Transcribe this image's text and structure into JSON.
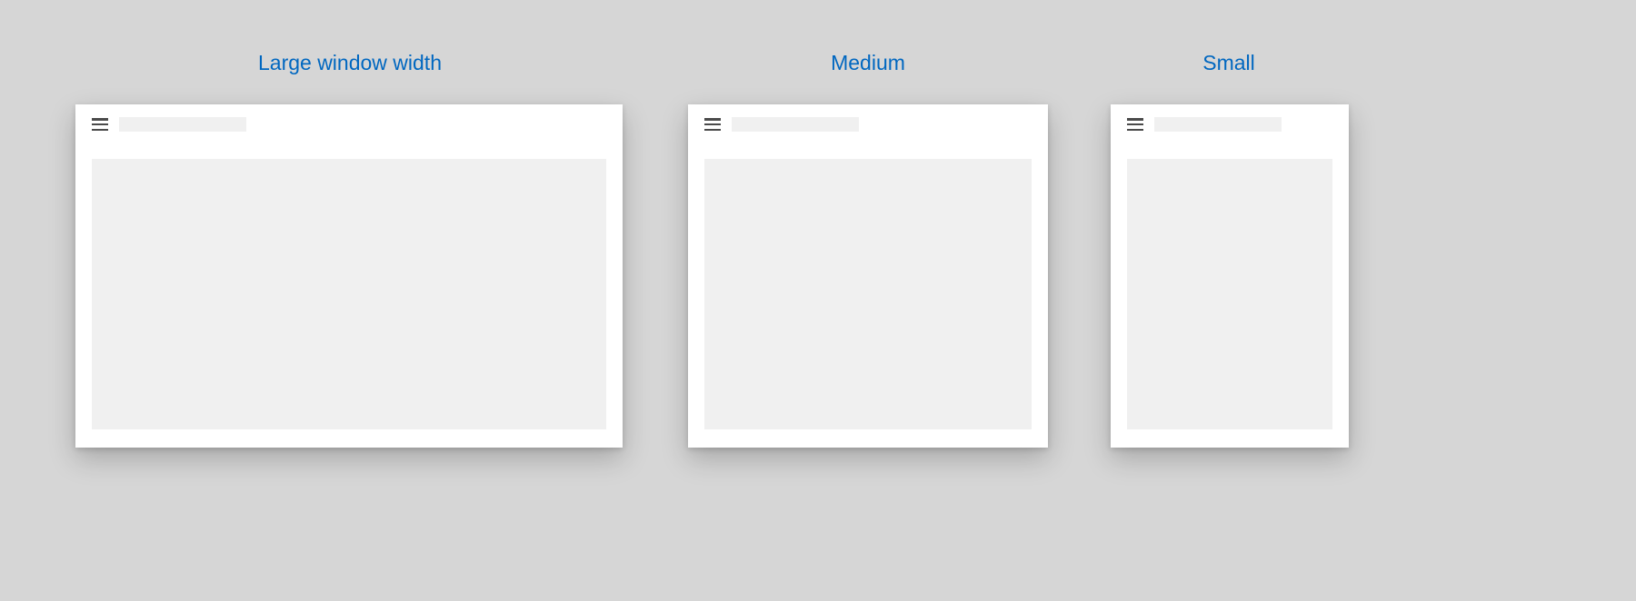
{
  "labels": {
    "large": "Large window width",
    "medium": "Medium",
    "small": "Small"
  }
}
